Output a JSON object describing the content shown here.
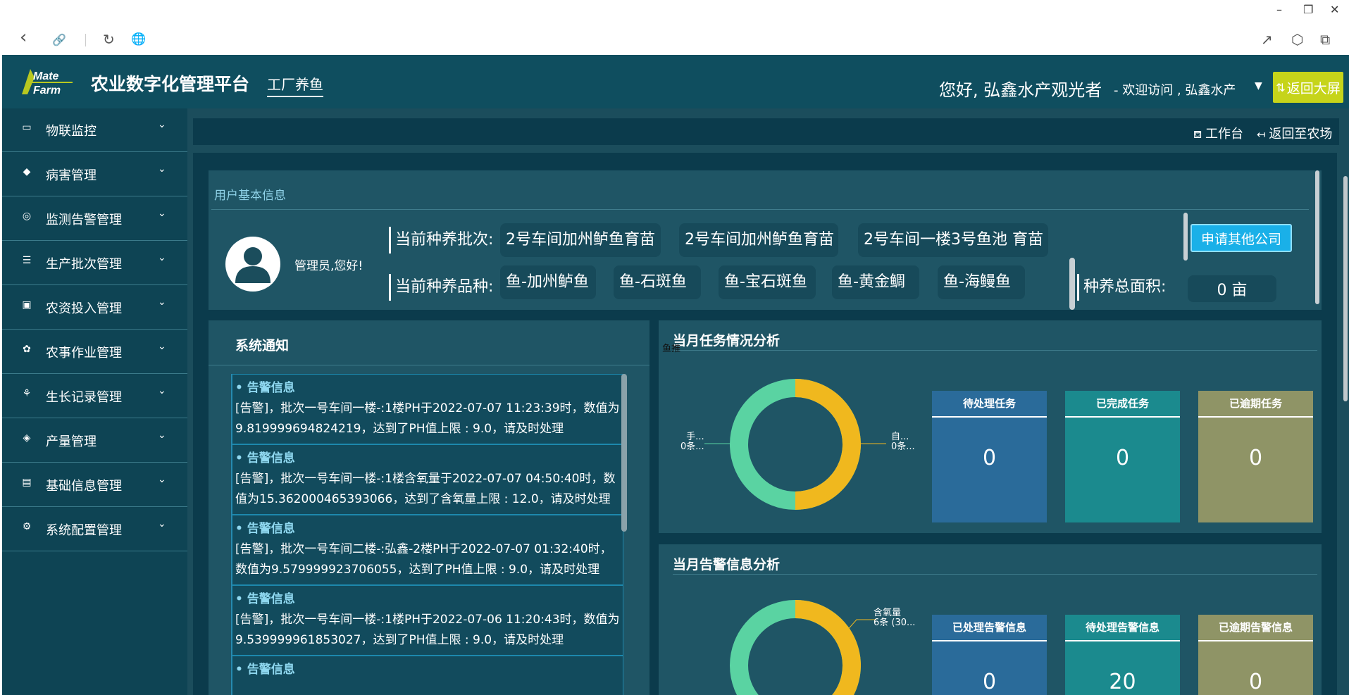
{
  "window_controls": {
    "minimize": "–",
    "maximize": "❐",
    "close": "✕"
  },
  "browser": {
    "back": "‹",
    "link": "🔗",
    "reload": "↻",
    "globe": "🌐",
    "share": "↗",
    "cube": "⬡",
    "ext": "⧉"
  },
  "header": {
    "logo_line1": "Mate",
    "logo_line2": "Farm",
    "title": "农业数字化管理平台",
    "tab": "工厂养鱼",
    "greeting": "您好, 弘鑫水产观光者",
    "welcome": "- 欢迎访问 , 弘鑫水产",
    "return_screen": "返回大屏"
  },
  "sidebar": {
    "items": [
      {
        "icon": "▭",
        "label": "物联监控"
      },
      {
        "icon": "◆",
        "label": "病害管理"
      },
      {
        "icon": "◎",
        "label": "监测告警管理"
      },
      {
        "icon": "☰",
        "label": "生产批次管理"
      },
      {
        "icon": "▣",
        "label": "农资投入管理"
      },
      {
        "icon": "✿",
        "label": "农事作业管理"
      },
      {
        "icon": "⚘",
        "label": "生长记录管理"
      },
      {
        "icon": "◈",
        "label": "产量管理"
      },
      {
        "icon": "▤",
        "label": "基础信息管理"
      },
      {
        "icon": "⚙",
        "label": "系统配置管理"
      }
    ]
  },
  "subbar": {
    "workbench": "工作台",
    "back_farm": "返回至农场"
  },
  "user_info": {
    "title": "用户基本信息",
    "admin_greeting": "管理员,您好!",
    "batch_label": "当前种养批次:",
    "batches": [
      "2号车间加州鲈鱼育苗",
      "2号车间加州鲈鱼育苗",
      "2号车间一楼3号鱼池 育苗"
    ],
    "species_label": "当前种养品种:",
    "species": [
      "鱼-加州鲈鱼",
      "鱼-石斑鱼",
      "鱼-宝石斑鱼",
      "鱼-黄金鲷",
      "鱼-海鳗鱼"
    ],
    "apply_button": "申请其他公司",
    "area_label": "种养总面积:",
    "area_value": "0 亩"
  },
  "notices": {
    "title": "系统通知",
    "items": [
      {
        "title": "• 告警信息",
        "body": "[告警]，批次一号车间一楼-:1楼PH于2022-07-07 11:23:39时，数值为9.819999694824219，达到了PH值上限 : 9.0，请及时处理"
      },
      {
        "title": "• 告警信息",
        "body": "[告警]，批次一号车间一楼-:1楼含氧量于2022-07-07 04:50:40时，数值为15.362000465393066，达到了含氧量上限 : 12.0，请及时处理"
      },
      {
        "title": "• 告警信息",
        "body": "[告警]，批次一号车间二楼-:弘鑫-2楼PH于2022-07-07 01:32:40时，数值为9.579999923706055，达到了PH值上限 : 9.0，请及时处理"
      },
      {
        "title": "• 告警信息",
        "body": "[告警]，批次一号车间一楼-:1楼PH于2022-07-06 11:20:43时，数值为9.539999961853027，达到了PH值上限 : 9.0，请及时处理"
      },
      {
        "title": "• 告警信息",
        "body": ""
      }
    ]
  },
  "task_panel": {
    "title": "当月任务情况分析",
    "fish_tag": "鱼推",
    "donut_left": [
      "手...",
      "0条..."
    ],
    "donut_right": [
      "自...",
      "0条..."
    ],
    "cards": [
      {
        "label": "待处理任务",
        "value": "0",
        "color": "#2a6b9a"
      },
      {
        "label": "已完成任务",
        "value": "0",
        "color": "#1b8a8e"
      },
      {
        "label": "已逾期任务",
        "value": "0",
        "color": "#8f9466"
      }
    ]
  },
  "alarm_panel": {
    "title": "当月告警信息分析",
    "donut_right": [
      "含氧量",
      "6条 (30..."
    ],
    "cards": [
      {
        "label": "已处理告警信息",
        "value": "0",
        "color": "#2a6b9a"
      },
      {
        "label": "待处理告警信息",
        "value": "20",
        "color": "#1b8a8e"
      },
      {
        "label": "已逾期告警信息",
        "value": "0",
        "color": "#8f9466"
      }
    ]
  },
  "colors": {
    "accent_yellow": "#c6d41a",
    "donut_green": "#5ad3a2",
    "donut_yellow": "#f0b81e"
  }
}
